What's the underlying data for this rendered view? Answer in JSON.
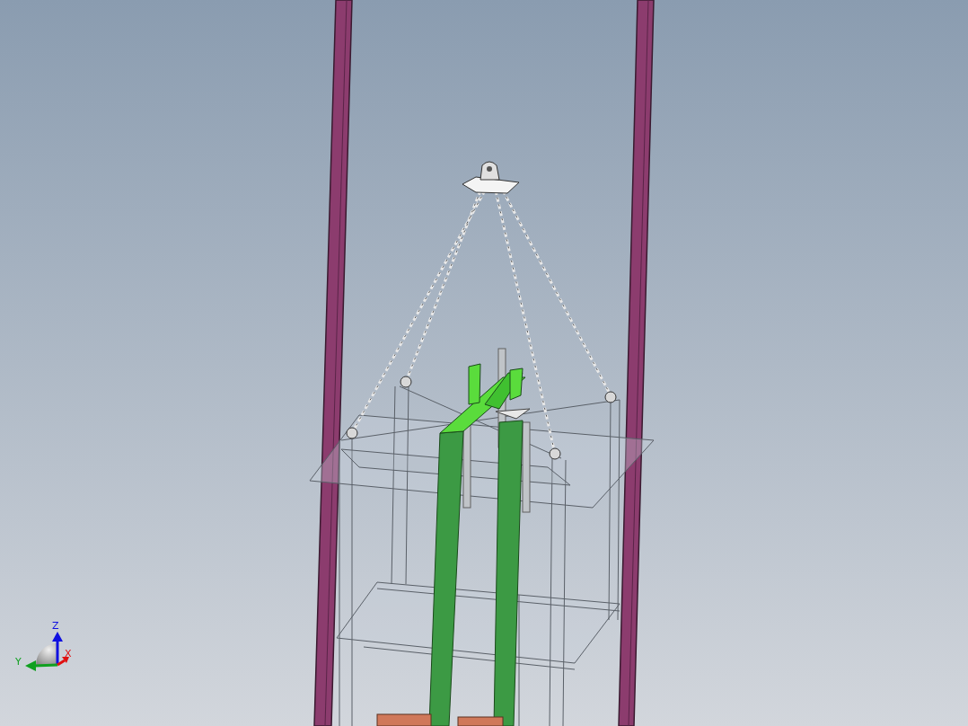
{
  "triad": {
    "axes": [
      {
        "label": "Z",
        "color": "#1010e0"
      },
      {
        "label": "Y",
        "color": "#10a020"
      },
      {
        "label": "X",
        "color": "#e01010"
      }
    ]
  }
}
